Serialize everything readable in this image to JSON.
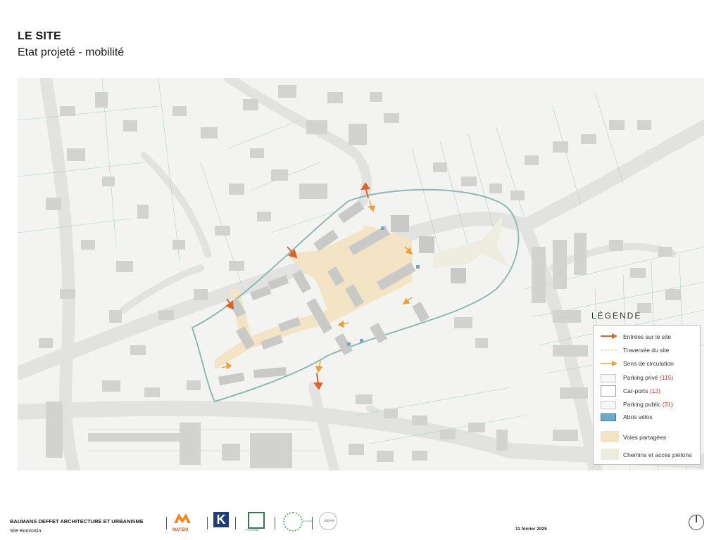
{
  "header": {
    "title": "LE SITE",
    "subtitle": "Etat projeté - mobilité"
  },
  "legend": {
    "title": "LÉGENDE",
    "items": [
      {
        "id": "entries",
        "label": "Entrées sur le site",
        "symbol": "arrow",
        "color": "#d9642b"
      },
      {
        "id": "crossing",
        "label": "Traversée du site",
        "symbol": "dashed-line",
        "color": "#e6b87a"
      },
      {
        "id": "circulation",
        "label": "Sens de circulation",
        "symbol": "arrow",
        "color": "#e8a33a"
      },
      {
        "id": "parking-private",
        "label": "Parking privé",
        "count": "(115)",
        "symbol": "box",
        "color": "#f7f7f7"
      },
      {
        "id": "car-ports",
        "label": "Car-ports",
        "count": "(12)",
        "symbol": "box",
        "color": "#ffffff"
      },
      {
        "id": "parking-public",
        "label": "Parking public",
        "count": "(31)",
        "symbol": "box",
        "color": "#f7f7f7"
      },
      {
        "id": "bike-shelters",
        "label": "Abris vélos",
        "symbol": "box",
        "color": "#6fa8c9"
      },
      {
        "id": "shared-roads",
        "label": "Voies partagées",
        "symbol": "fill",
        "color": "#f4e4c6"
      },
      {
        "id": "paths",
        "label": "Chemins et accès piétons",
        "symbol": "fill",
        "color": "#efece0"
      }
    ]
  },
  "footer": {
    "firm": "BAUMANS DEFFET ARCHITECTURE ET URBANISME",
    "site": "Site Bonvoisin",
    "date": "11 février 2025",
    "logos": [
      "MATEXI",
      "K",
      "PL-LIVING",
      "ecologie",
      "cdome"
    ]
  },
  "colors": {
    "building": "#d2d3d1",
    "road": "#e3e3e1",
    "parcel_line": "#8fc9bd",
    "site_boundary": "#8fb8b2",
    "shared_road": "#f4e4c6",
    "pedestrian": "#efece0",
    "entry_arrow": "#d9642b",
    "circulation_arrow": "#e8a33a"
  }
}
